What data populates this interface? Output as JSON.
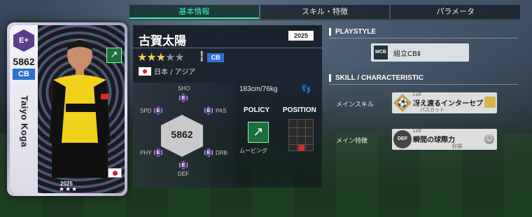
{
  "tabs": [
    {
      "label": "基本情報"
    },
    {
      "label": "スキル・特徴"
    },
    {
      "label": "パラメータ"
    }
  ],
  "card": {
    "rank": "E+",
    "overall": "5862",
    "position": "CB",
    "name_vertical": "Taiyo Koga",
    "year": "2025",
    "stars": "★★★"
  },
  "player": {
    "name": "古賀太陽",
    "year": "2025",
    "stars_filled": 3,
    "stars_total": 5,
    "position": "CB",
    "nationality": "日本 / アジア",
    "height_weight": "183cm/76kg",
    "overall": "5862"
  },
  "stats": {
    "sho": {
      "label": "SHO",
      "grade": "E"
    },
    "pas": {
      "label": "PAS",
      "grade": "E"
    },
    "drb": {
      "label": "DRB",
      "grade": "E"
    },
    "def": {
      "label": "DEF",
      "grade": "E"
    },
    "phy": {
      "label": "PHY",
      "grade": "E"
    },
    "spd": {
      "label": "SPD",
      "grade": "E"
    }
  },
  "policy": {
    "header": "POLICY",
    "label": "ムービング"
  },
  "position_map": {
    "header": "POSITION"
  },
  "playstyle": {
    "header": "PLAYSTYLE",
    "icon": "MCB",
    "label": "組立CBⅡ"
  },
  "skill": {
    "header": "SKILL / CHARACTERISTIC",
    "main_skill_label": "メインスキル",
    "main_skill": {
      "level": "Lv3",
      "name": "冴え渡るインターセプト",
      "sub": "パスカット"
    },
    "main_trait_label": "メイン特徴",
    "main_trait": {
      "icon": "DEF",
      "level": "Lv3",
      "name": "瞬間の球際力",
      "sub": "好調"
    }
  },
  "colors": {
    "accent": "#3ff0c0",
    "position_badge": "#2f6fd1",
    "star": "#f0cf55"
  }
}
